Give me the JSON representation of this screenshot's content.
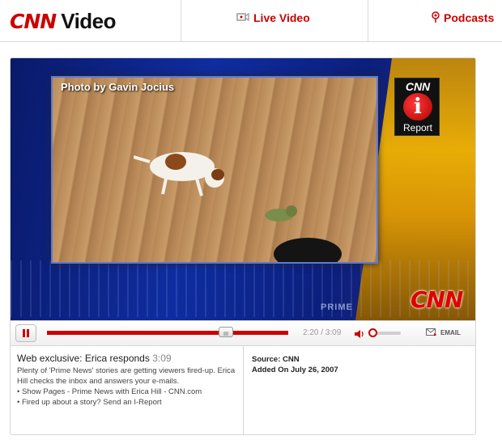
{
  "header": {
    "logo_cnn": "CNN",
    "logo_video": "Video",
    "nav": [
      {
        "label": "Live Video",
        "icon": "video-camera-icon"
      },
      {
        "label": "Podcasts",
        "icon": "podcast-icon"
      }
    ]
  },
  "player": {
    "photo_credit": "Photo by Gavin Jocius",
    "ireport": {
      "top": "CNN",
      "middle": "i",
      "bottom": "Report"
    },
    "network_bug": "CNN",
    "prime_text": "PRIME",
    "time": "2:20 / 3:09",
    "progress_fraction": 0.74,
    "volume_fraction": 0.05,
    "email_label": "EMAIL",
    "colors": {
      "accent": "#cc0000"
    }
  },
  "info": {
    "title": "Web exclusive: Erica responds",
    "duration": "3:09",
    "description": "Plenty of 'Prime News' stories are getting viewers fired-up. Erica Hill checks the inbox and answers your e-mails.",
    "links": [
      "• Show Pages - Prime News with Erica Hill - CNN.com",
      "• Fired up about a story? Send an I-Report"
    ],
    "source": "Source: CNN",
    "added": "Added On July 26, 2007"
  }
}
